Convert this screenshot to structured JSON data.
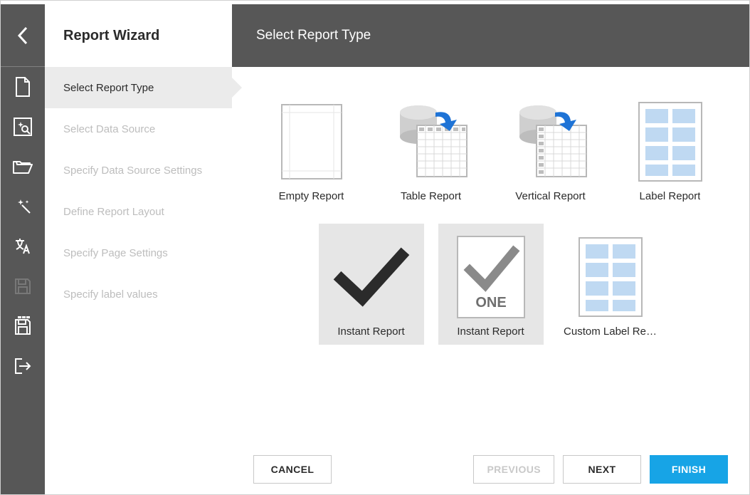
{
  "wizard": {
    "title": "Report Wizard",
    "steps": [
      {
        "label": "Select Report Type",
        "active": true
      },
      {
        "label": "Select Data Source",
        "active": false
      },
      {
        "label": "Specify Data Source Settings",
        "active": false
      },
      {
        "label": "Define Report Layout",
        "active": false
      },
      {
        "label": "Specify Page Settings",
        "active": false
      },
      {
        "label": "Specify label values",
        "active": false
      }
    ]
  },
  "header": {
    "title": "Select Report Type"
  },
  "reportTypes": [
    {
      "label": "Empty Report",
      "icon": "empty",
      "state": ""
    },
    {
      "label": "Table Report",
      "icon": "table",
      "state": ""
    },
    {
      "label": "Vertical Report",
      "icon": "vertical",
      "state": ""
    },
    {
      "label": "Label Report",
      "icon": "labels",
      "state": ""
    },
    {
      "label": "Instant Report",
      "icon": "check",
      "state": "selected"
    },
    {
      "label": "Instant Report",
      "icon": "check-one",
      "state": "hover"
    },
    {
      "label": "Custom Label Re…",
      "icon": "labels",
      "state": ""
    }
  ],
  "buttons": {
    "cancel": "CANCEL",
    "previous": "PREVIOUS",
    "next": "NEXT",
    "finish": "FINISH"
  }
}
